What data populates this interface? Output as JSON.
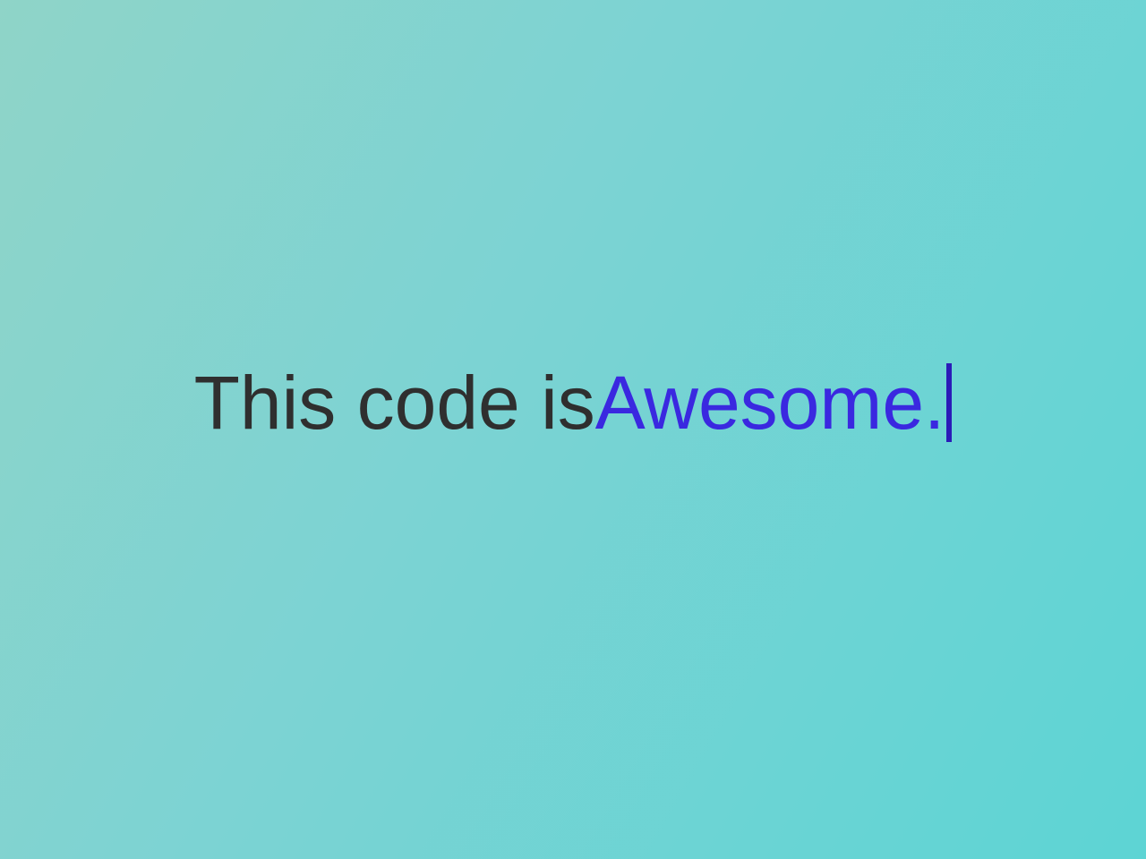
{
  "text": {
    "static": "This code is ",
    "dynamic": "Awesome."
  },
  "colors": {
    "static_text": "#2f2f2f",
    "dynamic_text": "#3a28e0",
    "cursor": "#2b1bb8"
  }
}
